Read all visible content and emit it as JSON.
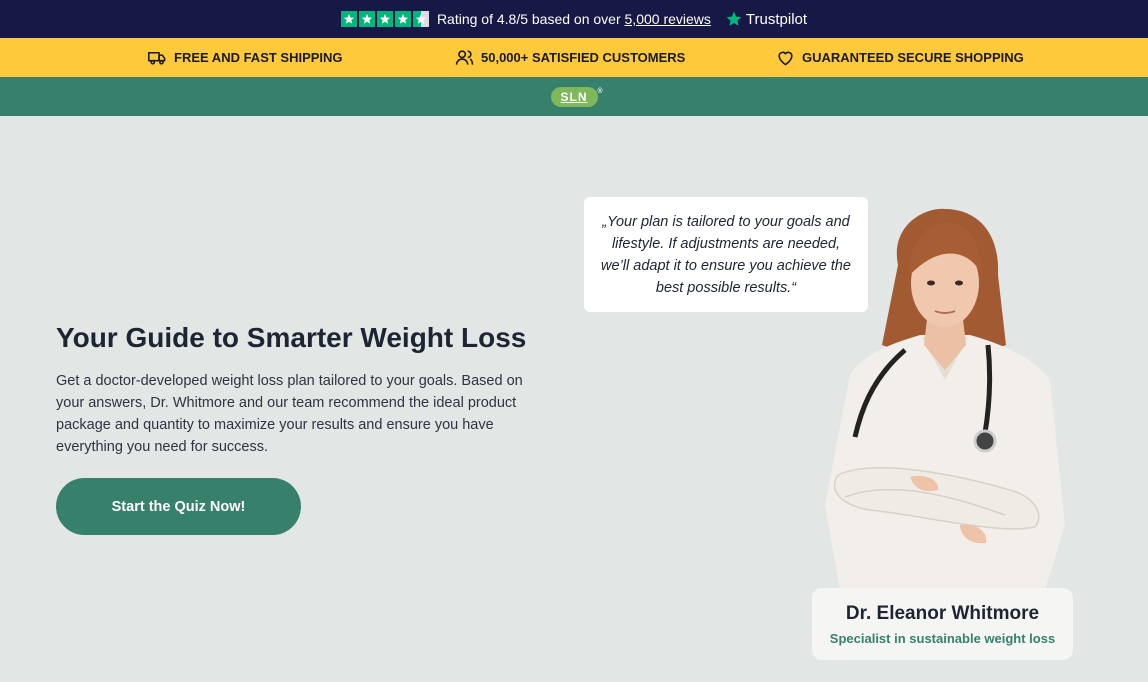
{
  "trustbar": {
    "rating_text": "Rating of 4.8/5 based on over",
    "reviews_link": "5,000 reviews",
    "brand": "Trustpilot",
    "star_color": "#00b67a",
    "icon": "star-icon"
  },
  "usps": [
    {
      "label": "FREE AND FAST SHIPPING",
      "icon": "truck-icon"
    },
    {
      "label": "50,000+ SATISFIED CUSTOMERS",
      "icon": "users-icon"
    },
    {
      "label": "GUARANTEED SECURE SHOPPING",
      "icon": "heart-icon"
    }
  ],
  "nav": {
    "logo": "SLN",
    "logo_mark": "®"
  },
  "hero": {
    "title": "Your Guide to Smarter Weight Loss",
    "description": "Get a doctor-developed weight loss plan tailored to your goals. Based on your answers, Dr. Whitmore and our team recommend the ideal product package and quantity to maximize your results and ensure you have everything you need for success.",
    "cta_label": "Start the Quiz Now!"
  },
  "quote": {
    "text": "„Your plan is tailored to your goals and lifestyle. If adjustments are needed, we’ll adapt it to ensure you achieve the best possible results.“"
  },
  "doctor": {
    "name": "Dr. Eleanor Whitmore",
    "role": "Specialist in sustainable weight loss"
  },
  "colors": {
    "topbar": "#171846",
    "accent_yellow": "#ffc93c",
    "brand_green": "#37806c",
    "background": "#e2e6e4"
  }
}
